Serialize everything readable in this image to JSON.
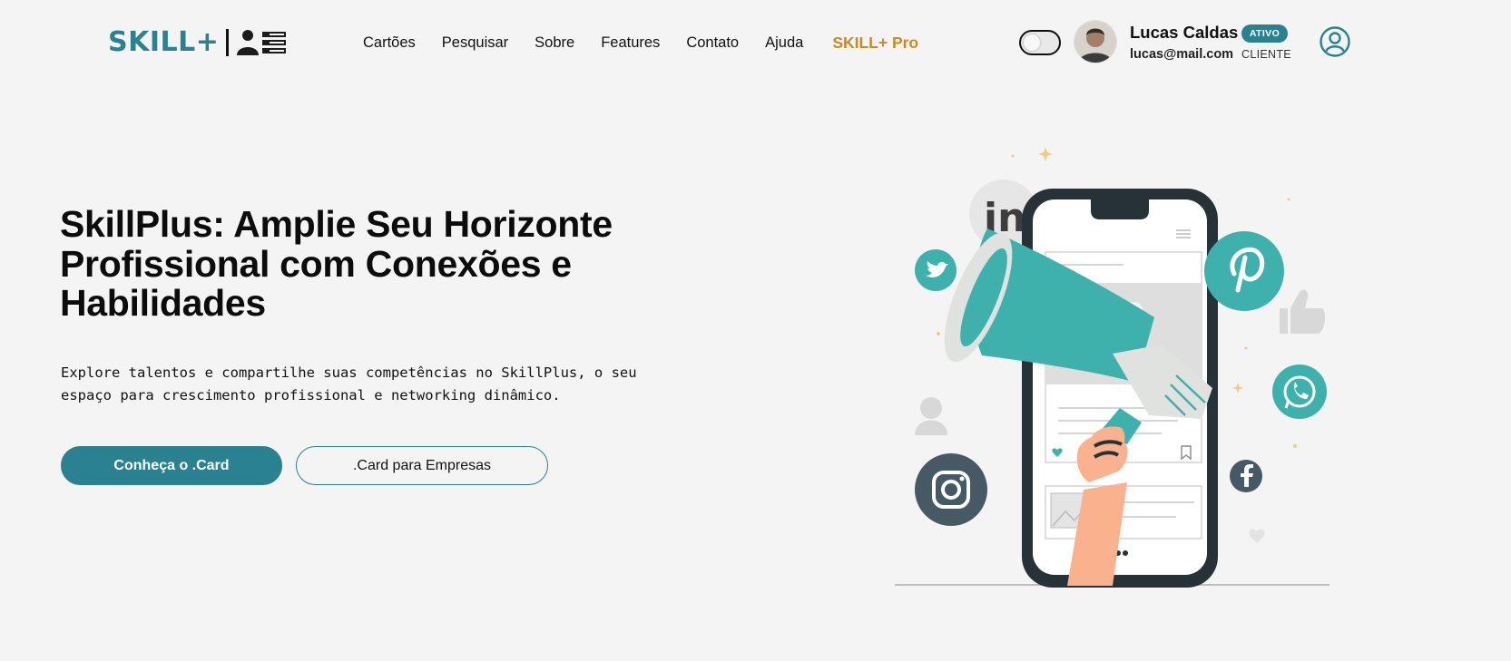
{
  "brand": {
    "name": "SKILL+"
  },
  "nav": {
    "items": [
      "Cartões",
      "Pesquisar",
      "Sobre",
      "Features",
      "Contato",
      "Ajuda"
    ],
    "pro_label": "SKILL+ Pro"
  },
  "user": {
    "name": "Lucas Caldas",
    "status": "ATIVO",
    "email": "lucas@mail.com",
    "role": "CLIENTE"
  },
  "hero": {
    "title": "SkillPlus: Amplie Seu Horizonte Profissional com Conexões e Habilidades",
    "description": "Explore talentos e compartilhe suas competências no SkillPlus, o seu espaço para crescimento profissional e networking dinâmico.",
    "primary_button": "Conheça o .Card",
    "secondary_button": ".Card para Empresas"
  },
  "illustration": {
    "linkedin_text": "in"
  },
  "colors": {
    "brand_teal": "#2a8290",
    "pro_gold": "#c98a24",
    "background": "#f4f4f4",
    "illustration_teal": "#3fb1ad",
    "illustration_dark": "#455a64"
  },
  "icons": [
    "people-list-icon",
    "theme-toggle",
    "user-circle-icon",
    "twitter-icon",
    "linkedin-icon",
    "pinterest-icon",
    "whatsapp-icon",
    "instagram-icon",
    "facebook-icon",
    "thumbs-up-icon",
    "heart-icon",
    "megaphone-icon"
  ]
}
